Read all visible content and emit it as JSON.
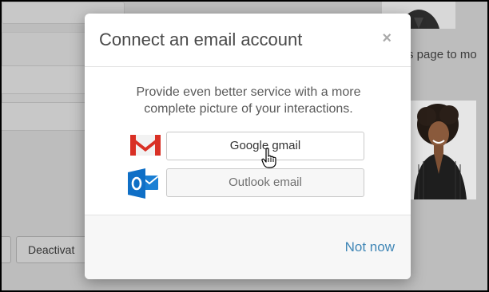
{
  "background": {
    "partial_text": "s page to mo",
    "deactivate_label": "Deactivat"
  },
  "modal": {
    "title": "Connect an email account",
    "close_glyph": "×",
    "prompt": "Provide even better service with a more complete picture of your interactions.",
    "providers": [
      {
        "label": "Google gmail",
        "icon": "gmail-icon"
      },
      {
        "label": "Outlook email",
        "icon": "outlook-icon"
      }
    ],
    "not_now_label": "Not now"
  },
  "colors": {
    "link": "#3f86b6",
    "gmail_red": "#d93025",
    "outlook_blue": "#0f6fc6"
  }
}
